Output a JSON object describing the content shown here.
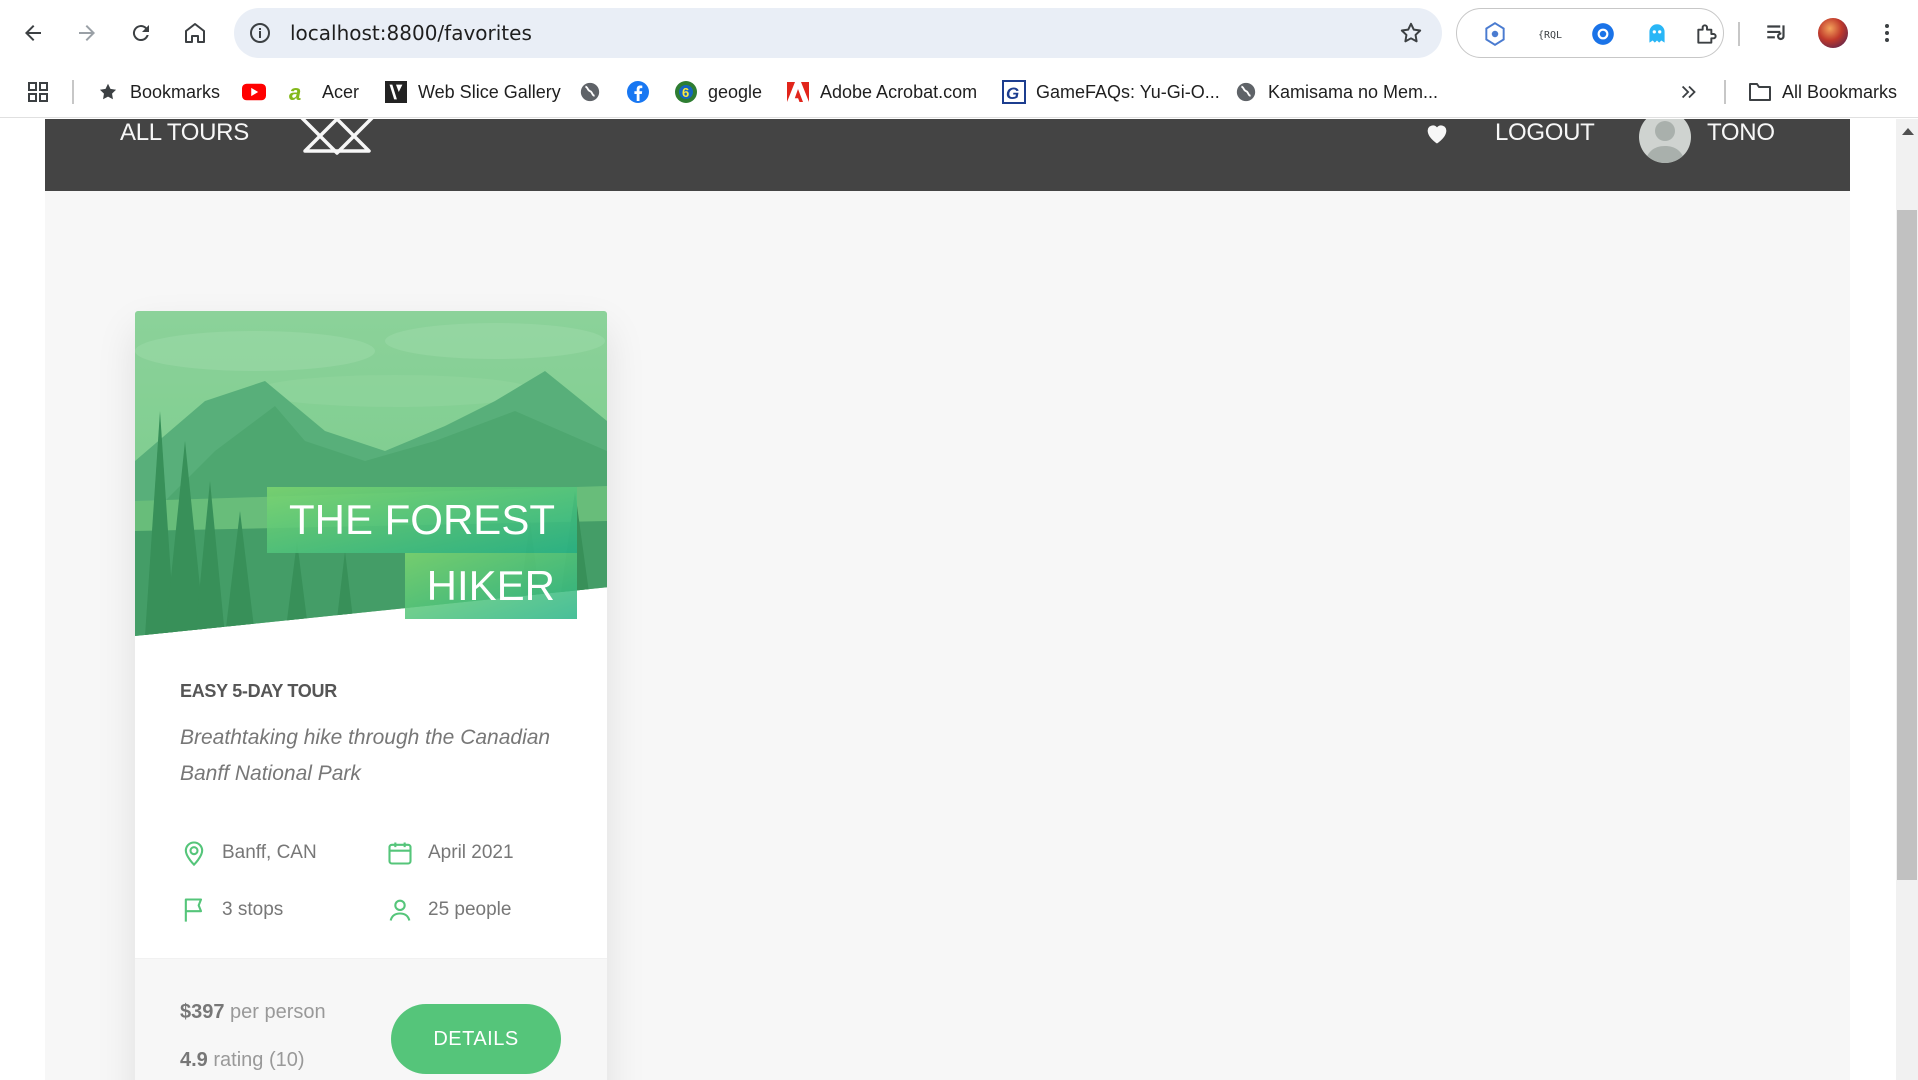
{
  "browser": {
    "url": "localhost:8800/favorites",
    "bookmarks": [
      {
        "label": "Bookmarks",
        "icon": "star-icon"
      },
      {
        "label": "",
        "icon": "youtube-icon"
      },
      {
        "label": "Acer",
        "icon": "acer-icon"
      },
      {
        "label": "Web Slice Gallery",
        "icon": "web-slice-icon"
      },
      {
        "label": "",
        "icon": "globe-icon"
      },
      {
        "label": "",
        "icon": "facebook-icon"
      },
      {
        "label": "geogle",
        "icon": "geogle-icon"
      },
      {
        "label": "Adobe Acrobat.com",
        "icon": "adobe-icon"
      },
      {
        "label": "GameFAQs: Yu-Gi-O...",
        "icon": "gamefaqs-icon"
      },
      {
        "label": "Kamisama no Mem...",
        "icon": "globe-icon"
      }
    ],
    "all_bookmarks": "All Bookmarks",
    "accent": "#1a73e8"
  },
  "site_header": {
    "all_tours": "ALL TOURS",
    "logout": "LOGOUT",
    "user_name": "TONO"
  },
  "card": {
    "title_line1": "THE FOREST",
    "title_line2": "HIKER",
    "sub_heading": "EASY 5-DAY TOUR",
    "summary": "Breathtaking hike through the Canadian Banff National Park",
    "location": "Banff, CAN",
    "date": "April 2021",
    "stops": "3 stops",
    "people": "25 people",
    "price_value": "$397",
    "price_unit": " per person",
    "rating_value": "4.9",
    "rating_unit": " rating (10)",
    "button": "DETAILS",
    "accent": "#55c57a"
  }
}
